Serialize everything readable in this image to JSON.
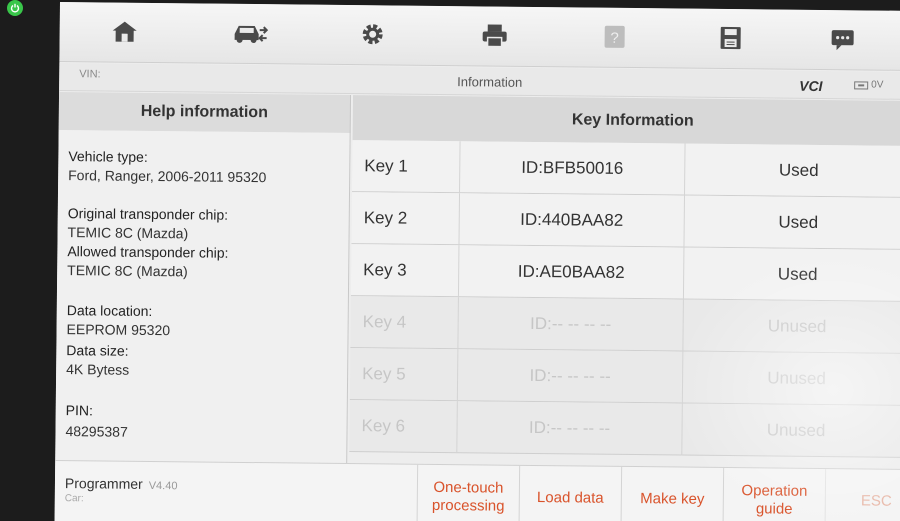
{
  "toolbar": {
    "icons": [
      "home-icon",
      "vehicle-swap-icon",
      "settings-gear-icon",
      "printer-icon",
      "help-icon",
      "save-icon",
      "message-icon"
    ]
  },
  "infobar": {
    "vin_label": "VIN:",
    "title": "Information",
    "vci_label": "VCI",
    "voltage": "0V"
  },
  "help": {
    "header": "Help information",
    "fields": [
      {
        "label": "Vehicle type:",
        "value": "Ford, Ranger, 2006-2011 95320"
      },
      {
        "label": "Original transponder chip:",
        "value": "TEMIC 8C (Mazda)"
      },
      {
        "label": "Allowed transponder chip:",
        "value": "TEMIC 8C (Mazda)"
      },
      {
        "label": "Data location:",
        "value": "EEPROM 95320"
      },
      {
        "label": "Data size:",
        "value": "4K Bytess"
      },
      {
        "label": "PIN:",
        "value": "48295387"
      }
    ]
  },
  "keys": {
    "header": "Key Information",
    "rows": [
      {
        "name": "Key 1",
        "id": "ID:BFB50016",
        "status": "Used",
        "active": true
      },
      {
        "name": "Key 2",
        "id": "ID:440BAA82",
        "status": "Used",
        "active": true
      },
      {
        "name": "Key 3",
        "id": "ID:AE0BAA82",
        "status": "Used",
        "active": true
      },
      {
        "name": "Key 4",
        "id": "ID:-- -- -- --",
        "status": "Unused",
        "active": false
      },
      {
        "name": "Key 5",
        "id": "ID:-- -- -- --",
        "status": "Unused",
        "active": false
      },
      {
        "name": "Key 6",
        "id": "ID:-- -- -- --",
        "status": "Unused",
        "active": false
      }
    ]
  },
  "footer": {
    "app_name": "Programmer",
    "version": "V4.40",
    "car_label": "Car:",
    "buttons": [
      {
        "label": "One-touch processing"
      },
      {
        "label": "Load data"
      },
      {
        "label": "Make key"
      },
      {
        "label": "Operation guide"
      },
      {
        "label": "ESC"
      }
    ]
  },
  "colors": {
    "accent": "#d9532b",
    "power": "#39c64a"
  }
}
